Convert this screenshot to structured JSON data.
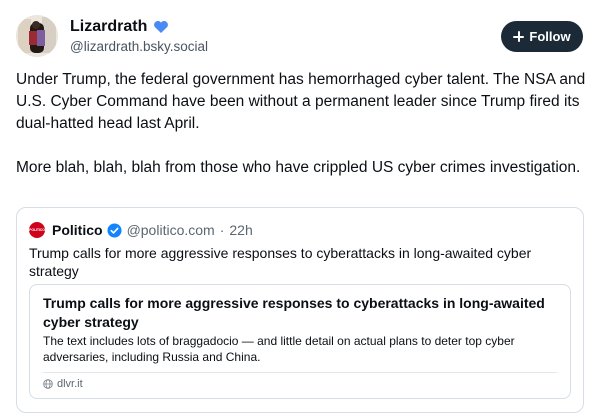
{
  "author": {
    "name": "Lizardrath",
    "handle": "@lizardrath.bsky.social",
    "badge_icon": "blue-heart-icon",
    "badge_color": "#4a8af4"
  },
  "follow_button": {
    "label": "Follow",
    "icon": "plus-icon",
    "background": "#1c2a38"
  },
  "post": {
    "paragraphs": [
      "Under Trump, the federal government has hemorrhaged cyber talent. The NSA and U.S. Cyber Command have been without a permanent leader since Trump fired its dual-hatted head last April.",
      "More blah, blah, blah from those who have crippled US cyber crimes investigation."
    ]
  },
  "quote": {
    "logo_text": "POLITICO",
    "name": "Politico",
    "verified_icon": "blue-check-icon",
    "handle": "@politico.com",
    "separator": "·",
    "time": "22h",
    "text": "Trump calls for more aggressive responses to cyberattacks in long-awaited cyber strategy",
    "link_card": {
      "title": "Trump calls for more aggressive responses to cyberattacks in long-awaited cyber strategy",
      "description": "The text includes lots of braggadocio — and little detail on actual plans to deter top cyber adversaries, including Russia and China.",
      "domain_icon": "globe-icon",
      "domain": "dlvr.it"
    }
  }
}
